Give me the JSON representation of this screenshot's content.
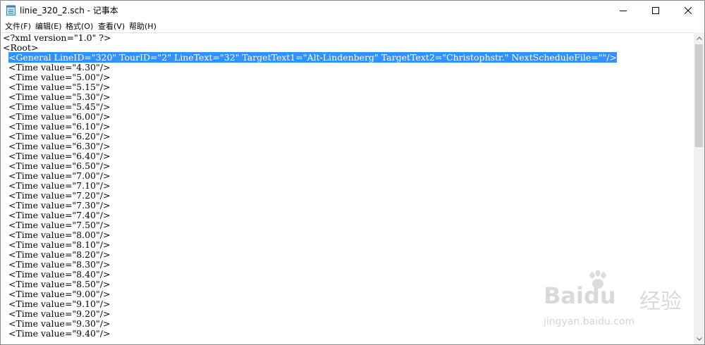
{
  "window": {
    "title": "linie_320_2.sch - 记事本"
  },
  "menu": [
    "文件(F)",
    "编辑(E)",
    "格式(O)",
    "查看(V)",
    "帮助(H)"
  ],
  "editor": {
    "lines": [
      "<?xml version=\"1.0\" ?>",
      "<Root>",
      "  <General LineID=\"320\" TourID=\"2\" LineText=\"32\" TargetText1=\"Alt-Lindenberg\" TargetText2=\"Christophstr.\" NextScheduleFile=\"\"/>",
      "  <Time value=\"4.30\"/>",
      "  <Time value=\"5.00\"/>",
      "  <Time value=\"5.15\"/>",
      "  <Time value=\"5.30\"/>",
      "  <Time value=\"5.45\"/>",
      "  <Time value=\"6.00\"/>",
      "  <Time value=\"6.10\"/>",
      "  <Time value=\"6.20\"/>",
      "  <Time value=\"6.30\"/>",
      "  <Time value=\"6.40\"/>",
      "  <Time value=\"6.50\"/>",
      "  <Time value=\"7.00\"/>",
      "  <Time value=\"7.10\"/>",
      "  <Time value=\"7.20\"/>",
      "  <Time value=\"7.30\"/>",
      "  <Time value=\"7.40\"/>",
      "  <Time value=\"7.50\"/>",
      "  <Time value=\"8.00\"/>",
      "  <Time value=\"8.10\"/>",
      "  <Time value=\"8.20\"/>",
      "  <Time value=\"8.30\"/>",
      "  <Time value=\"8.40\"/>",
      "  <Time value=\"8.50\"/>",
      "  <Time value=\"9.00\"/>",
      "  <Time value=\"9.10\"/>",
      "  <Time value=\"9.20\"/>",
      "  <Time value=\"9.30\"/>",
      "  <Time value=\"9.40\"/>"
    ],
    "selected_line_index": 2,
    "selection_color": "#3390ff"
  },
  "watermark": {
    "brand": "Baidu",
    "brand_cn": "经验",
    "url": "jingyan.baidu.com"
  },
  "icons": {
    "app": "notepad-icon",
    "minimize": "minimize-icon",
    "maximize": "maximize-icon",
    "close": "close-icon"
  }
}
